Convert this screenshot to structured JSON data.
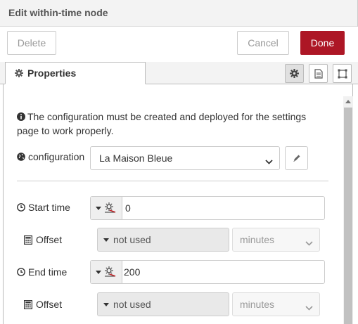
{
  "tray": {
    "title": "Edit within-time node"
  },
  "toolbar": {
    "delete_label": "Delete",
    "cancel_label": "Cancel",
    "done_label": "Done",
    "primary_color": "#ad1625"
  },
  "tabs": {
    "properties_label": "Properties",
    "icons": [
      "gear-icon",
      "document-icon",
      "frame-icon"
    ]
  },
  "notice": {
    "text": "The configuration must be created and deployed for the settings page to work properly."
  },
  "config": {
    "label": "configuration",
    "value": "La Maison Bleue"
  },
  "start_time": {
    "label": "Start time",
    "value": "0"
  },
  "start_offset": {
    "label": "Offset",
    "type_value": "not used",
    "unit": "minutes"
  },
  "end_time": {
    "label": "End time",
    "value": "200"
  },
  "end_offset": {
    "label": "Offset",
    "type_value": "not used",
    "unit": "minutes"
  }
}
